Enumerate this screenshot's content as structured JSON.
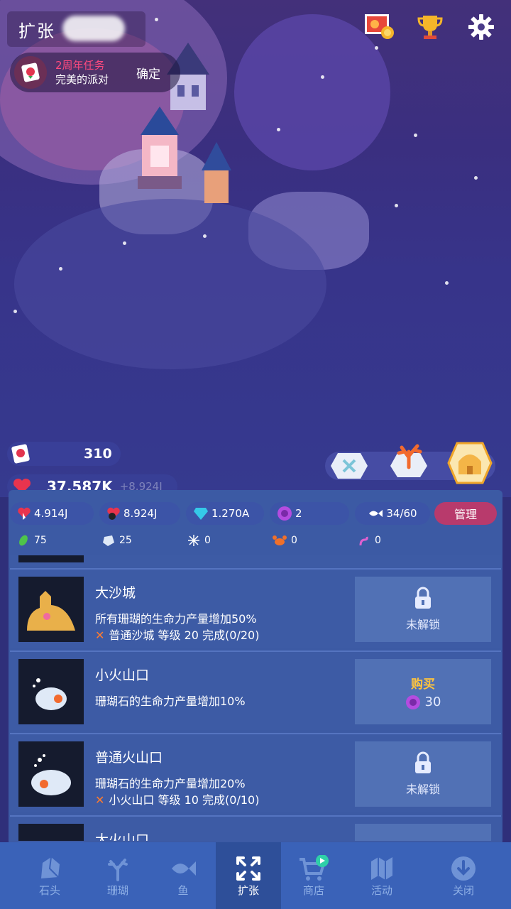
{
  "header": {
    "title": "扩张",
    "quest": {
      "tag": "2周年任务",
      "name": "完美的派对",
      "confirm": "确定"
    }
  },
  "top_icons": [
    "photo-medal-icon",
    "trophy-icon",
    "gear-icon"
  ],
  "stats": {
    "cards": "310",
    "life": "37.587K",
    "life_rate": "+8.924J"
  },
  "resources": {
    "tap": "4.914J",
    "idle": "8.924J",
    "gem": "1.270A",
    "pearl": "2",
    "fish": "34/60",
    "manage": "管理"
  },
  "counts": {
    "plant": "75",
    "rock": "25",
    "urchin": "0",
    "crab": "0",
    "worm": "0"
  },
  "items": [
    {
      "name": "大沙城",
      "desc": "所有珊瑚的生命力产量增加50%",
      "req": "普通沙城 等级 20 完成(0/20)",
      "status": "未解锁"
    },
    {
      "name": "小火山口",
      "desc": "珊瑚石的生命力产量增加10%",
      "req": "",
      "buy": "购买",
      "price": "30"
    },
    {
      "name": "普通火山口",
      "desc": "珊瑚石的生命力产量增加20%",
      "req": "小火山口 等级 10 完成(0/10)",
      "status": "未解锁"
    },
    {
      "name": "大火山口"
    }
  ],
  "tabs": [
    "石头",
    "珊瑚",
    "鱼",
    "扩张",
    "商店",
    "活动",
    "关闭"
  ],
  "colors": {
    "accent_pink": "#b83a6c",
    "quest_red": "#ff4a7e",
    "buy_yellow": "#ffc43d",
    "panel_blue": "#3d5ba5"
  }
}
